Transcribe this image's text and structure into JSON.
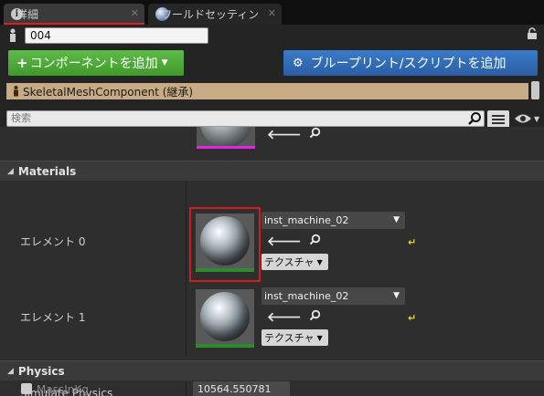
{
  "tabs": [
    {
      "label": "詳細",
      "icon": "info-icon",
      "active": true
    },
    {
      "label": "ワールドセッティング",
      "icon": "globe-icon",
      "active": false
    }
  ],
  "actor_name": {
    "value": "004"
  },
  "buttons": {
    "add_component": "コンポーネントを追加",
    "blueprint_script": "ブループリント/スクリプトを追加"
  },
  "component": {
    "label": "SkeletalMeshComponent (継承)"
  },
  "search": {
    "placeholder": "検索"
  },
  "sections": {
    "materials": "Materials",
    "physics": "Physics"
  },
  "materials": [
    {
      "label": "エレメント 0",
      "material": "inst_machine_02",
      "texture_button": "テクスチャ",
      "selected": true
    },
    {
      "label": "エレメント 1",
      "material": "inst_machine_02",
      "texture_button": "テクスチャ",
      "selected": false
    }
  ],
  "physics": {
    "simulate_label": "Simulate Physics",
    "mass_label": "MassInKg",
    "mass_value": "10564.550781"
  },
  "colors": {
    "accent_red": "#d01e1e",
    "add_button": "#4aa935",
    "blueprint_button": "#2f6db5",
    "component_row": "#c8ab85"
  }
}
